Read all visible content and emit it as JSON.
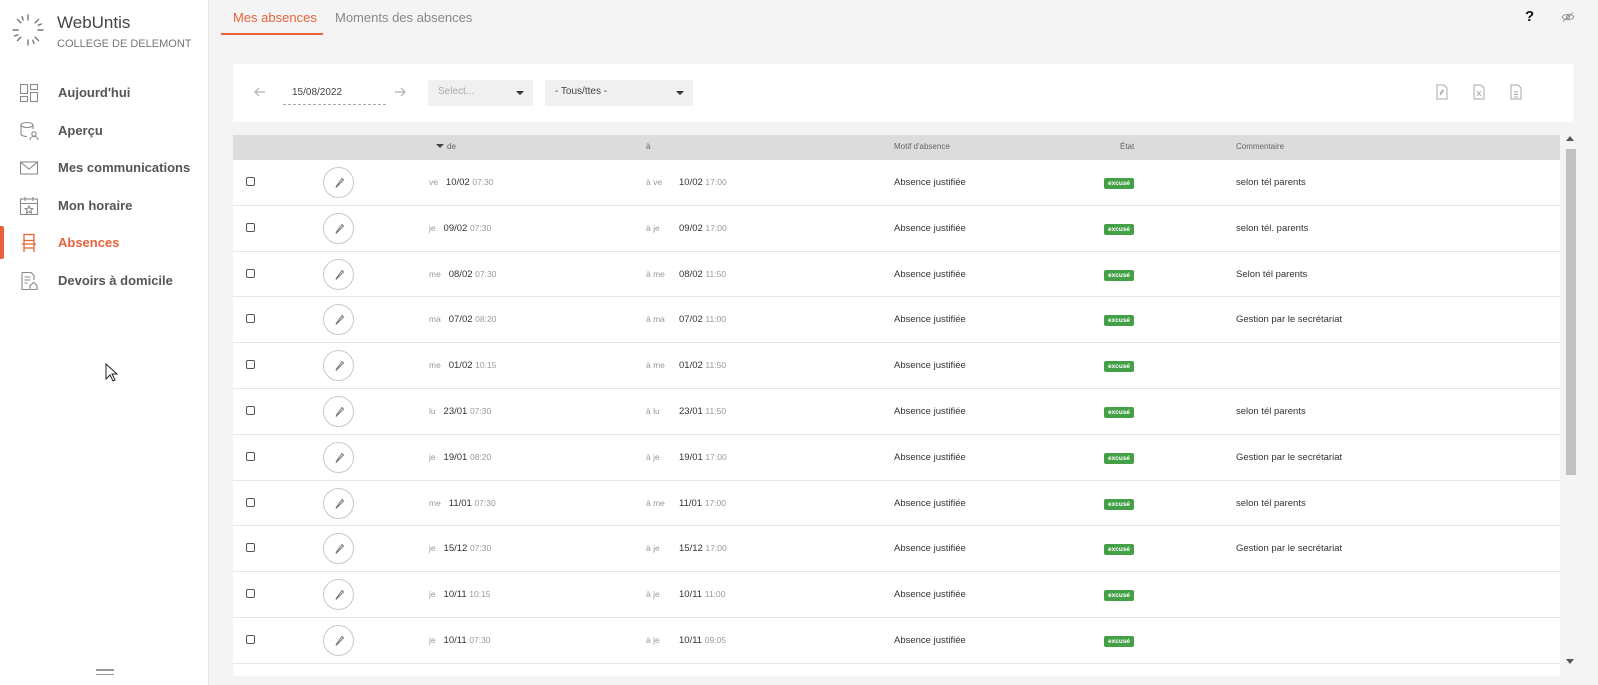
{
  "brand": {
    "name": "WebUntis",
    "school": "COLLEGE DE DELEMONT"
  },
  "nav": [
    {
      "label": "Aujourd'hui",
      "icon": "dashboard-icon",
      "active": false
    },
    {
      "label": "Aperçu",
      "icon": "students-overview-icon",
      "active": false
    },
    {
      "label": "Mes communications",
      "icon": "mail-icon",
      "active": false
    },
    {
      "label": "Mon horaire",
      "icon": "calendar-icon",
      "active": false
    },
    {
      "label": "Absences",
      "icon": "chair-icon",
      "active": true
    },
    {
      "label": "Devoirs à domicile",
      "icon": "homework-icon",
      "active": false
    }
  ],
  "tabs": [
    {
      "label": "Mes absences",
      "active": true
    },
    {
      "label": "Moments des absences",
      "active": false
    }
  ],
  "header": {
    "help_label": "?",
    "eye_icon": "eye-slash-icon"
  },
  "filter": {
    "date": "15/08/2022",
    "prev_icon": "arrow-left-icon",
    "next_icon": "arrow-right-icon",
    "select1_placeholder": "Select...",
    "select2_value": "- Tous/ttes -",
    "exports": [
      "pdf-export-icon",
      "excel-export-icon",
      "csv-export-icon"
    ]
  },
  "table": {
    "headers": {
      "from": "de",
      "to": "à",
      "reason": "Motif d'absence",
      "state": "État",
      "comment": "Commentaire"
    },
    "rows": [
      {
        "from_day": "ve",
        "from_date": "10/02",
        "from_time": "07:30",
        "to_prefix": "à ve",
        "to_date": "10/02",
        "to_time": "17:00",
        "reason": "Absence justifiée",
        "state": "excusé",
        "comment": "selon tél parents"
      },
      {
        "from_day": "je",
        "from_date": "09/02",
        "from_time": "07:30",
        "to_prefix": "à je",
        "to_date": "09/02",
        "to_time": "17:00",
        "reason": "Absence justifiée",
        "state": "excusé",
        "comment": "selon tél. parents"
      },
      {
        "from_day": "me",
        "from_date": "08/02",
        "from_time": "07:30",
        "to_prefix": "à me",
        "to_date": "08/02",
        "to_time": "11:50",
        "reason": "Absence justifiée",
        "state": "excusé",
        "comment": "Selon tél parents"
      },
      {
        "from_day": "ma",
        "from_date": "07/02",
        "from_time": "08:20",
        "to_prefix": "à ma",
        "to_date": "07/02",
        "to_time": "11:00",
        "reason": "Absence justifiée",
        "state": "excusé",
        "comment": "Gestion par le secrétariat"
      },
      {
        "from_day": "me",
        "from_date": "01/02",
        "from_time": "10:15",
        "to_prefix": "à me",
        "to_date": "01/02",
        "to_time": "11:50",
        "reason": "Absence justifiée",
        "state": "excusé",
        "comment": ""
      },
      {
        "from_day": "lu",
        "from_date": "23/01",
        "from_time": "07:30",
        "to_prefix": "à lu",
        "to_date": "23/01",
        "to_time": "11:50",
        "reason": "Absence justifiée",
        "state": "excusé",
        "comment": "selon tél parents"
      },
      {
        "from_day": "je",
        "from_date": "19/01",
        "from_time": "08:20",
        "to_prefix": "à je",
        "to_date": "19/01",
        "to_time": "17:00",
        "reason": "Absence justifiée",
        "state": "excusé",
        "comment": "Gestion par le secrétariat"
      },
      {
        "from_day": "me",
        "from_date": "11/01",
        "from_time": "07:30",
        "to_prefix": "à me",
        "to_date": "11/01",
        "to_time": "17:00",
        "reason": "Absence justifiée",
        "state": "excusé",
        "comment": "selon tél parents"
      },
      {
        "from_day": "je",
        "from_date": "15/12",
        "from_time": "07:30",
        "to_prefix": "à je",
        "to_date": "15/12",
        "to_time": "17:00",
        "reason": "Absence justifiée",
        "state": "excusé",
        "comment": "Gestion par le secrétariat"
      },
      {
        "from_day": "je",
        "from_date": "10/11",
        "from_time": "10:15",
        "to_prefix": "à je",
        "to_date": "10/11",
        "to_time": "11:00",
        "reason": "Absence justifiée",
        "state": "excusé",
        "comment": ""
      },
      {
        "from_day": "je",
        "from_date": "10/11",
        "from_time": "07:30",
        "to_prefix": "à je",
        "to_date": "10/11",
        "to_time": "09:05",
        "reason": "Absence justifiée",
        "state": "excusé",
        "comment": ""
      }
    ]
  },
  "colors": {
    "accent": "#e8633b",
    "badge_green": "#43a047"
  }
}
